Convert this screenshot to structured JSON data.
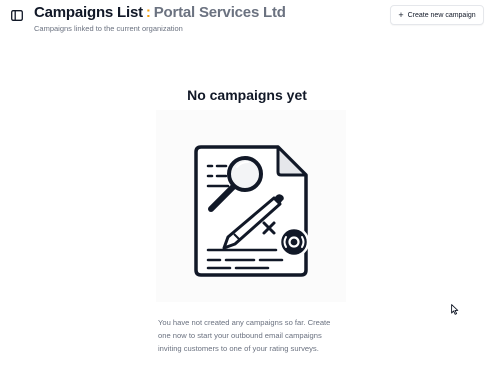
{
  "header": {
    "title": "Campaigns List",
    "separator": ":",
    "org_name": "Portal Services Ltd",
    "subtitle": "Campaigns linked to the current organization",
    "sidebar_toggle_icon": "sidebar-panel-icon",
    "create_button": {
      "icon": "plus-icon",
      "label": "Create new campaign"
    }
  },
  "empty_state": {
    "title": "No campaigns yet",
    "illustration_icon": "document-search-edit-icon",
    "description": "You have not created any campaigns so far. Create one now to start your outbound email campaigns inviting customers to one of your rating surveys."
  },
  "colors": {
    "accent": "#f59e0b",
    "muted_text": "#6b7280",
    "primary_text": "#111827"
  }
}
